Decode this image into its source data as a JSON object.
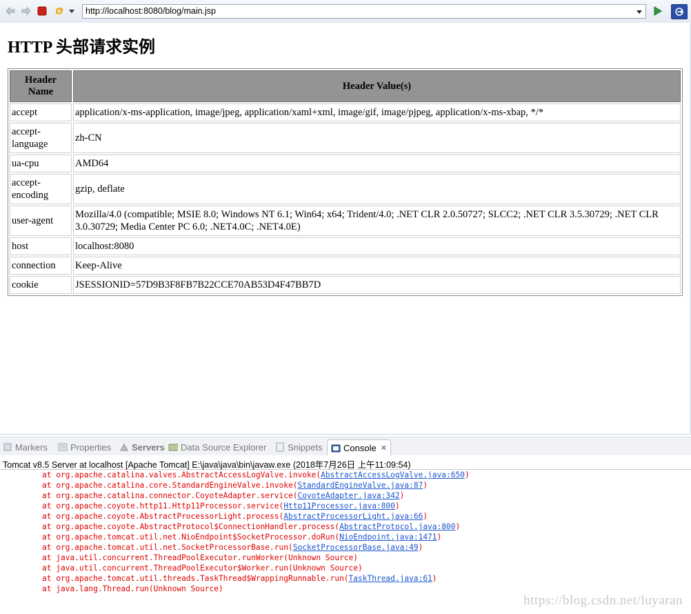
{
  "browser": {
    "url": "http://localhost:8080/blog/main.jsp",
    "icons": [
      "back-icon",
      "forward-icon",
      "stop-icon",
      "refresh-icon",
      "dropdown-icon",
      "go-icon",
      "open-external-icon"
    ]
  },
  "page": {
    "title": "HTTP 头部请求实例",
    "table": {
      "headers": [
        "Header Name",
        "Header Value(s)"
      ],
      "rows": [
        {
          "name": "accept",
          "value": "application/x-ms-application, image/jpeg, application/xaml+xml, image/gif, image/pjpeg, application/x-ms-xbap, */*"
        },
        {
          "name": "accept-language",
          "value": "zh-CN"
        },
        {
          "name": "ua-cpu",
          "value": "AMD64"
        },
        {
          "name": "accept-encoding",
          "value": "gzip, deflate"
        },
        {
          "name": "user-agent",
          "value": "Mozilla/4.0 (compatible; MSIE 8.0; Windows NT 6.1; Win64; x64; Trident/4.0; .NET CLR 2.0.50727; SLCC2; .NET CLR 3.5.30729; .NET CLR 3.0.30729; Media Center PC 6.0; .NET4.0C; .NET4.0E)"
        },
        {
          "name": "host",
          "value": "localhost:8080"
        },
        {
          "name": "connection",
          "value": "Keep-Alive"
        },
        {
          "name": "cookie",
          "value": "JSESSIONID=57D9B3F8FB7B22CCE70AB53D4F47BB7D"
        }
      ]
    }
  },
  "views": {
    "tabs": [
      {
        "label": "Markers",
        "icon": "markers-icon"
      },
      {
        "label": "Properties",
        "icon": "properties-icon"
      },
      {
        "label": "Servers",
        "icon": "servers-icon"
      },
      {
        "label": "Data Source Explorer",
        "icon": "data-source-icon"
      },
      {
        "label": "Snippets",
        "icon": "snippets-icon"
      },
      {
        "label": "Console",
        "icon": "console-icon",
        "active": true
      }
    ],
    "console_title": "Tomcat v8.5 Server at localhost [Apache Tomcat] E:\\java\\java\\bin\\javaw.exe (2018年7月26日 上午11:09:54)",
    "stack": [
      {
        "text": "at org.apache.catalina.valves.AbstractAccessLogValve.invoke(",
        "link": "AbstractAccessLogValve.java:650",
        "tail": ")"
      },
      {
        "text": "at org.apache.catalina.core.StandardEngineValve.invoke(",
        "link": "StandardEngineValve.java:87",
        "tail": ")"
      },
      {
        "text": "at org.apache.catalina.connector.CoyoteAdapter.service(",
        "link": "CoyoteAdapter.java:342",
        "tail": ")"
      },
      {
        "text": "at org.apache.coyote.http11.Http11Processor.service(",
        "link": "Http11Processor.java:800",
        "tail": ")"
      },
      {
        "text": "at org.apache.coyote.AbstractProcessorLight.process(",
        "link": "AbstractProcessorLight.java:66",
        "tail": ")"
      },
      {
        "text": "at org.apache.coyote.AbstractProtocol$ConnectionHandler.process(",
        "link": "AbstractProtocol.java:800",
        "tail": ")"
      },
      {
        "text": "at org.apache.tomcat.util.net.NioEndpoint$SocketProcessor.doRun(",
        "link": "NioEndpoint.java:1471",
        "tail": ")"
      },
      {
        "text": "at org.apache.tomcat.util.net.SocketProcessorBase.run(",
        "link": "SocketProcessorBase.java:49",
        "tail": ")"
      },
      {
        "text": "at java.util.concurrent.ThreadPoolExecutor.runWorker(Unknown Source)",
        "link": "",
        "tail": ""
      },
      {
        "text": "at java.util.concurrent.ThreadPoolExecutor$Worker.run(Unknown Source)",
        "link": "",
        "tail": ""
      },
      {
        "text": "at org.apache.tomcat.util.threads.TaskThread$WrappingRunnable.run(",
        "link": "TaskThread.java:61",
        "tail": ")"
      },
      {
        "text": "at java.lang.Thread.run(Unknown Source)",
        "link": "",
        "tail": ""
      }
    ]
  },
  "watermark": "https://blog.csdn.net/luyaran",
  "colors": {
    "error_text": "#e20000",
    "link": "#1a55d0",
    "table_header_bg": "#949494"
  }
}
